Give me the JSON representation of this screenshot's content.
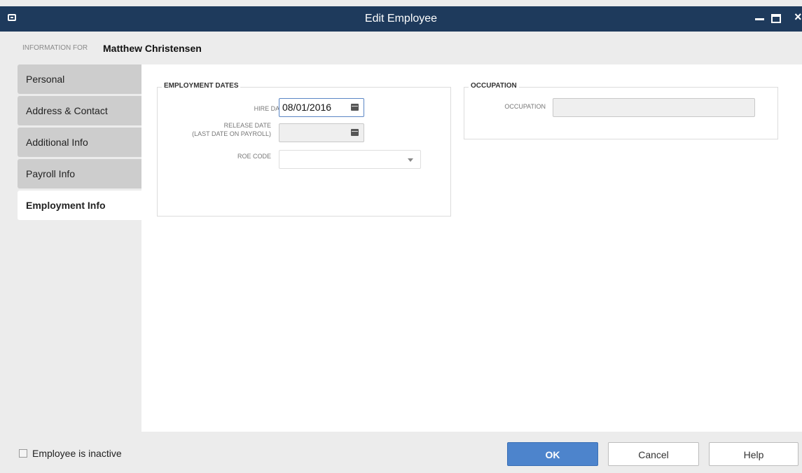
{
  "window": {
    "title": "Edit Employee",
    "system_icon": "window-menu-icon",
    "controls": {
      "minimize": "minimize-icon",
      "maximize": "maximize-icon",
      "close": "×"
    }
  },
  "header": {
    "info_label": "INFORMATION FOR",
    "employee_name": "Matthew Christensen"
  },
  "tabs": [
    {
      "label": "Personal",
      "active": false
    },
    {
      "label": "Address & Contact",
      "active": false
    },
    {
      "label": "Additional Info",
      "active": false
    },
    {
      "label": "Payroll Info",
      "active": false
    },
    {
      "label": "Employment Info",
      "active": true
    }
  ],
  "employment_dates": {
    "title": "EMPLOYMENT DATES",
    "hire_date_label": "HIRE DATE",
    "hire_date_value": "08/01/2016",
    "release_date_label_1": "RELEASE DATE",
    "release_date_label_2": "(LAST DATE ON PAYROLL)",
    "release_date_value": "",
    "roe_code_label": "ROE CODE",
    "roe_code_value": ""
  },
  "occupation": {
    "title": "OCCUPATION",
    "label": "OCCUPATION",
    "value": ""
  },
  "footer": {
    "inactive_label": "Employee is inactive",
    "inactive_checked": false,
    "ok_label": "OK",
    "cancel_label": "Cancel",
    "help_label": "Help"
  },
  "colors": {
    "titlebar": "#1e3a5c",
    "primary_button": "#4d84cc",
    "active_field_border": "#5b86c5"
  }
}
